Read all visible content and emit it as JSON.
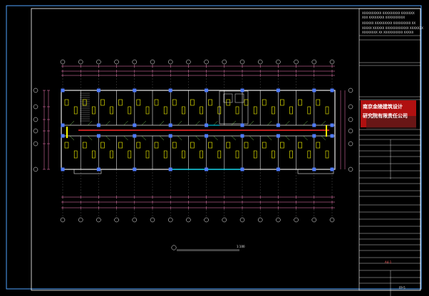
{
  "drawing": {
    "background": "#000000",
    "frame_color": "#ffffff",
    "wall_color": "#e8e8e8",
    "axis_color": "#ff7fbf",
    "grid_color": "#808080",
    "column_color": "#4f7cff",
    "fixture_color": "#ffff00",
    "corridor_color": "#ff2a2a",
    "door_color": "#00e5ff",
    "axis_count_horizontal": 16,
    "axis_count_vertical": 6
  },
  "title_block": {
    "notes": [
      "XXXXXXXXXX XXXXXXXXX XXXXXXX",
      "XXX XXXXXXXX XXXXXXXXXX",
      "XXXXXX XXXXXXXXX XXXXXXXXX XX",
      "XXXXX XXXXXX XXXXXXXXXXXX XXXXXXX",
      "XXXXXXXX XX XXXXXXXXXX XXXXX"
    ],
    "company_line1": "南京金陵建筑设计",
    "company_line2": "研究院有限责任公司",
    "sheet_code": "A4-1",
    "sheet_no": "FP-5",
    "scale_label": "1:100"
  }
}
